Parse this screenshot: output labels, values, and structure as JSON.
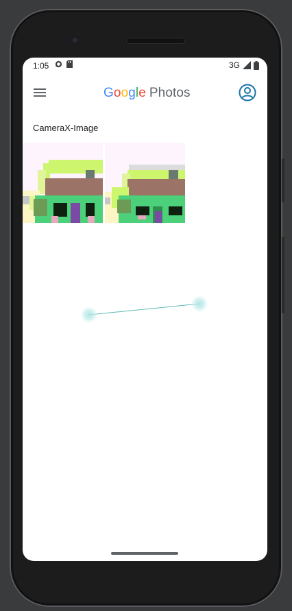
{
  "status_bar": {
    "time": "1:05",
    "network": "3G",
    "left_icons": [
      "whatsapp-icon",
      "sd-card-icon"
    ],
    "right_icons": [
      "signal-icon",
      "battery-icon"
    ]
  },
  "app_bar": {
    "menu_icon": "hamburger-menu-icon",
    "logo_letters": [
      "G",
      "o",
      "o",
      "g",
      "l",
      "e"
    ],
    "logo_suffix": "Photos",
    "account_icon": "account-circle-icon",
    "colors": {
      "blue": "#4285F4",
      "red": "#EA4335",
      "yellow": "#FBBC05",
      "green": "#34A853",
      "account": "#1a73a6"
    }
  },
  "album": {
    "title": "CameraX-Image",
    "photos": [
      {
        "name": "photo-1"
      },
      {
        "name": "photo-2"
      }
    ]
  }
}
